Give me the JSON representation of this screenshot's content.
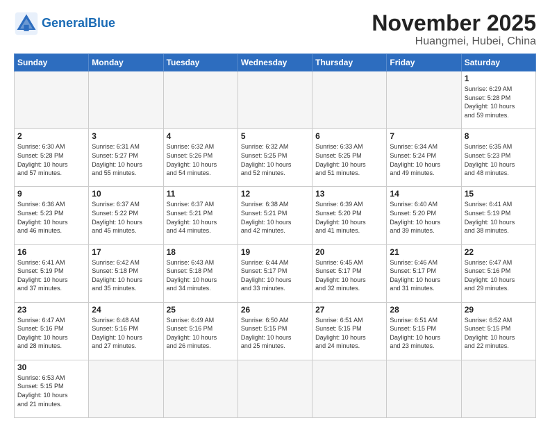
{
  "header": {
    "logo_general": "General",
    "logo_blue": "Blue",
    "title": "November 2025",
    "subtitle": "Huangmei, Hubei, China"
  },
  "weekdays": [
    "Sunday",
    "Monday",
    "Tuesday",
    "Wednesday",
    "Thursday",
    "Friday",
    "Saturday"
  ],
  "days": [
    {
      "num": "",
      "info": "",
      "empty": true
    },
    {
      "num": "",
      "info": "",
      "empty": true
    },
    {
      "num": "",
      "info": "",
      "empty": true
    },
    {
      "num": "",
      "info": "",
      "empty": true
    },
    {
      "num": "",
      "info": "",
      "empty": true
    },
    {
      "num": "",
      "info": "",
      "empty": true
    },
    {
      "num": "1",
      "info": "Sunrise: 6:29 AM\nSunset: 5:28 PM\nDaylight: 10 hours\nand 59 minutes."
    },
    {
      "num": "2",
      "info": "Sunrise: 6:30 AM\nSunset: 5:28 PM\nDaylight: 10 hours\nand 57 minutes."
    },
    {
      "num": "3",
      "info": "Sunrise: 6:31 AM\nSunset: 5:27 PM\nDaylight: 10 hours\nand 55 minutes."
    },
    {
      "num": "4",
      "info": "Sunrise: 6:32 AM\nSunset: 5:26 PM\nDaylight: 10 hours\nand 54 minutes."
    },
    {
      "num": "5",
      "info": "Sunrise: 6:32 AM\nSunset: 5:25 PM\nDaylight: 10 hours\nand 52 minutes."
    },
    {
      "num": "6",
      "info": "Sunrise: 6:33 AM\nSunset: 5:25 PM\nDaylight: 10 hours\nand 51 minutes."
    },
    {
      "num": "7",
      "info": "Sunrise: 6:34 AM\nSunset: 5:24 PM\nDaylight: 10 hours\nand 49 minutes."
    },
    {
      "num": "8",
      "info": "Sunrise: 6:35 AM\nSunset: 5:23 PM\nDaylight: 10 hours\nand 48 minutes."
    },
    {
      "num": "9",
      "info": "Sunrise: 6:36 AM\nSunset: 5:23 PM\nDaylight: 10 hours\nand 46 minutes."
    },
    {
      "num": "10",
      "info": "Sunrise: 6:37 AM\nSunset: 5:22 PM\nDaylight: 10 hours\nand 45 minutes."
    },
    {
      "num": "11",
      "info": "Sunrise: 6:37 AM\nSunset: 5:21 PM\nDaylight: 10 hours\nand 44 minutes."
    },
    {
      "num": "12",
      "info": "Sunrise: 6:38 AM\nSunset: 5:21 PM\nDaylight: 10 hours\nand 42 minutes."
    },
    {
      "num": "13",
      "info": "Sunrise: 6:39 AM\nSunset: 5:20 PM\nDaylight: 10 hours\nand 41 minutes."
    },
    {
      "num": "14",
      "info": "Sunrise: 6:40 AM\nSunset: 5:20 PM\nDaylight: 10 hours\nand 39 minutes."
    },
    {
      "num": "15",
      "info": "Sunrise: 6:41 AM\nSunset: 5:19 PM\nDaylight: 10 hours\nand 38 minutes."
    },
    {
      "num": "16",
      "info": "Sunrise: 6:41 AM\nSunset: 5:19 PM\nDaylight: 10 hours\nand 37 minutes."
    },
    {
      "num": "17",
      "info": "Sunrise: 6:42 AM\nSunset: 5:18 PM\nDaylight: 10 hours\nand 35 minutes."
    },
    {
      "num": "18",
      "info": "Sunrise: 6:43 AM\nSunset: 5:18 PM\nDaylight: 10 hours\nand 34 minutes."
    },
    {
      "num": "19",
      "info": "Sunrise: 6:44 AM\nSunset: 5:17 PM\nDaylight: 10 hours\nand 33 minutes."
    },
    {
      "num": "20",
      "info": "Sunrise: 6:45 AM\nSunset: 5:17 PM\nDaylight: 10 hours\nand 32 minutes."
    },
    {
      "num": "21",
      "info": "Sunrise: 6:46 AM\nSunset: 5:17 PM\nDaylight: 10 hours\nand 31 minutes."
    },
    {
      "num": "22",
      "info": "Sunrise: 6:47 AM\nSunset: 5:16 PM\nDaylight: 10 hours\nand 29 minutes."
    },
    {
      "num": "23",
      "info": "Sunrise: 6:47 AM\nSunset: 5:16 PM\nDaylight: 10 hours\nand 28 minutes."
    },
    {
      "num": "24",
      "info": "Sunrise: 6:48 AM\nSunset: 5:16 PM\nDaylight: 10 hours\nand 27 minutes."
    },
    {
      "num": "25",
      "info": "Sunrise: 6:49 AM\nSunset: 5:16 PM\nDaylight: 10 hours\nand 26 minutes."
    },
    {
      "num": "26",
      "info": "Sunrise: 6:50 AM\nSunset: 5:15 PM\nDaylight: 10 hours\nand 25 minutes."
    },
    {
      "num": "27",
      "info": "Sunrise: 6:51 AM\nSunset: 5:15 PM\nDaylight: 10 hours\nand 24 minutes."
    },
    {
      "num": "28",
      "info": "Sunrise: 6:51 AM\nSunset: 5:15 PM\nDaylight: 10 hours\nand 23 minutes."
    },
    {
      "num": "29",
      "info": "Sunrise: 6:52 AM\nSunset: 5:15 PM\nDaylight: 10 hours\nand 22 minutes."
    },
    {
      "num": "30",
      "info": "Sunrise: 6:53 AM\nSunset: 5:15 PM\nDaylight: 10 hours\nand 21 minutes."
    },
    {
      "num": "",
      "info": "",
      "empty": true
    },
    {
      "num": "",
      "info": "",
      "empty": true
    },
    {
      "num": "",
      "info": "",
      "empty": true
    },
    {
      "num": "",
      "info": "",
      "empty": true
    },
    {
      "num": "",
      "info": "",
      "empty": true
    },
    {
      "num": "",
      "info": "",
      "empty": true
    }
  ]
}
